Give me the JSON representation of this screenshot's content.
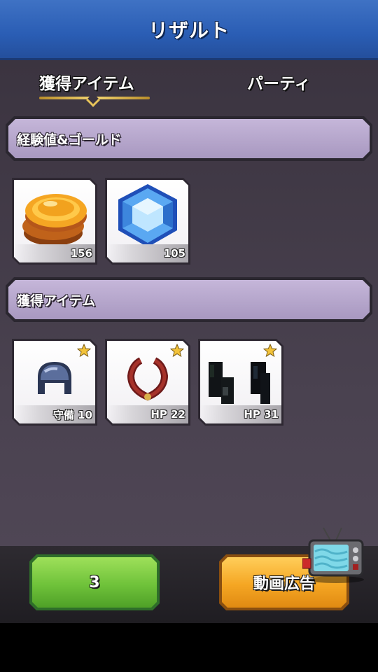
{
  "header": {
    "title": "リザルト"
  },
  "tabs": [
    {
      "label": "獲得アイテム",
      "active": true
    },
    {
      "label": "パーティ",
      "active": false
    }
  ],
  "sections": {
    "exp_gold": {
      "label": "経験値&ゴールド"
    },
    "items": {
      "label": "獲得アイテム"
    }
  },
  "rewards": [
    {
      "icon": "gold-coins-icon",
      "count": "156"
    },
    {
      "icon": "blue-gem-icon",
      "count": "105"
    }
  ],
  "items": [
    {
      "icon": "helmet-icon",
      "stat": "守備 10",
      "starred": true
    },
    {
      "icon": "red-necklace-icon",
      "stat": "HP 22",
      "starred": true
    },
    {
      "icon": "dark-boots-icon",
      "stat": "HP 31",
      "starred": true
    }
  ],
  "footer": {
    "left_button": "3",
    "right_button": "動画広告",
    "right_icon": "tv-ad-icon"
  },
  "colors": {
    "header_blue": "#2a5db4",
    "section_purple": "#b4a5cc",
    "green_button": "#6fc23a",
    "orange_button": "#f5a623",
    "tab_underline_gold": "#e8c45a",
    "star_gold": "#f3c33a"
  }
}
